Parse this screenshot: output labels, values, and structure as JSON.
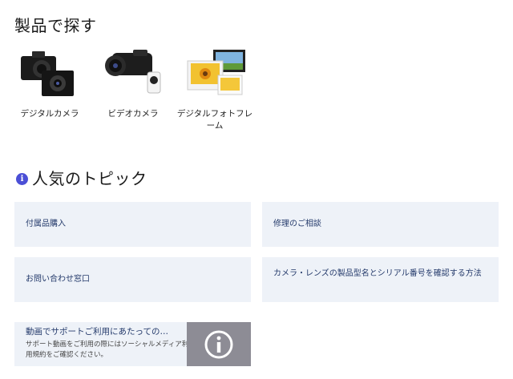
{
  "products": {
    "title": "製品で探す",
    "items": [
      {
        "label": "デジタルカメラ"
      },
      {
        "label": "ビデオカメラ"
      },
      {
        "label": "デジタルフォトフレーム"
      }
    ]
  },
  "topics": {
    "icon": "info-icon",
    "title": "人気のトピック",
    "cards": [
      {
        "label": "付属品購入"
      },
      {
        "label": "修理のご相談"
      },
      {
        "label": "お問い合わせ窓口"
      },
      {
        "label": "カメラ・レンズの製品型名とシリアル番号を確認する方法"
      }
    ]
  },
  "video_support": {
    "title": "動画でサポートご利用にあたっての…",
    "description": "サポート動画をご利用の際にはソーシャルメディア利用規約をご確認ください。",
    "icon": "info-circle-icon"
  },
  "colors": {
    "card_bg": "#eef2f8",
    "card_text": "#243a6b",
    "info_badge": "#4b4fd6",
    "video_thumb": "#8d8c95"
  }
}
